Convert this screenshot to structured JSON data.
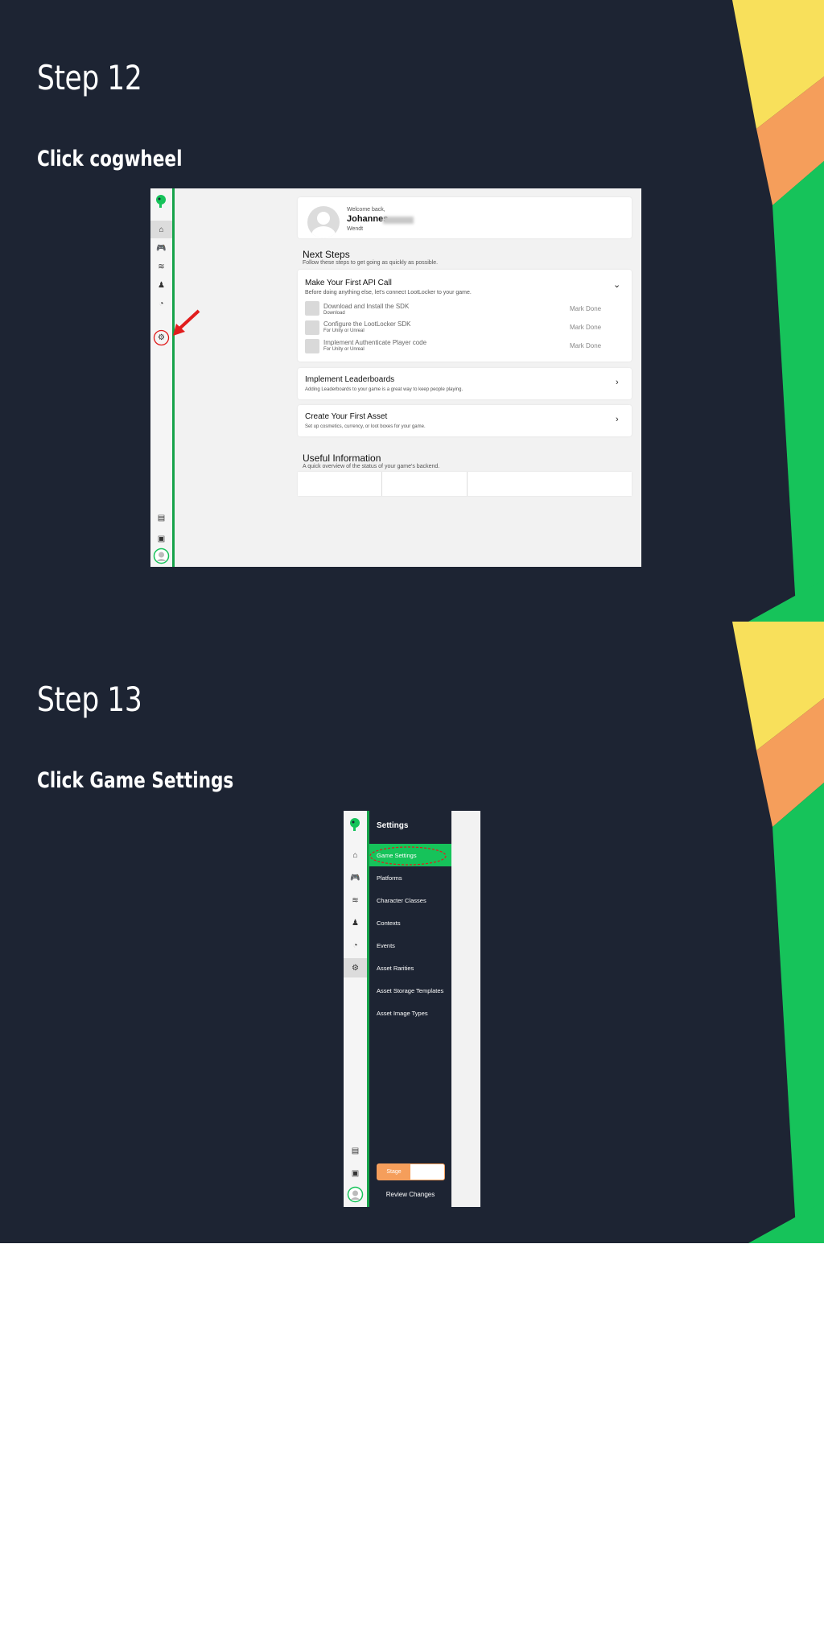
{
  "colors": {
    "slide_bg": "#1d2433",
    "accent_green": "#16c35a",
    "accent_orange": "#f59e5b",
    "accent_yellow": "#f8e05b",
    "highlight_red": "#e11d1d"
  },
  "step12": {
    "title": "Step 12",
    "instruction": "Click cogwheel",
    "screenshot": {
      "welcome": "Welcome back,",
      "user_name": "Johannes",
      "role": "Wendt",
      "next_steps_title": "Next Steps",
      "next_steps_sub": "Follow these steps to get going as quickly as possible.",
      "api_card": {
        "title": "Make Your First API Call",
        "sub": "Before doing anything else, let's connect LootLocker to your game.",
        "tasks": [
          {
            "label": "Download and Install the SDK",
            "sub": "Download",
            "action": "Mark Done"
          },
          {
            "label": "Configure the LootLocker SDK",
            "sub": "For Unity or Unreal",
            "action": "Mark Done"
          },
          {
            "label": "Implement Authenticate Player code",
            "sub": "For Unity or Unreal",
            "action": "Mark Done"
          }
        ]
      },
      "leaderboards_card": {
        "title": "Implement Leaderboards",
        "sub": "Adding Leaderboards to your game is a great way to keep people playing."
      },
      "asset_card": {
        "title": "Create Your First Asset",
        "sub": "Set up cosmetics, currency, or loot boxes for your game."
      },
      "useful_title": "Useful Information",
      "useful_sub": "A quick overview of the status of your game's backend."
    }
  },
  "step13": {
    "title": "Step 13",
    "instruction_prefix": "Click ",
    "instruction_bold": "Game Settings",
    "screenshot": {
      "menu_title": "Settings",
      "items": [
        "Game Settings",
        "Platforms",
        "Character Classes",
        "Contexts",
        "Events",
        "Asset Rarities",
        "Asset Storage Templates",
        "Asset Image Types"
      ],
      "stage_label": "Stage",
      "review_label": "Review Changes"
    }
  },
  "icons": [
    "home-icon",
    "gamepad-icon",
    "layers-icon",
    "player-icon",
    "gauge-icon",
    "gear-icon",
    "book-icon",
    "discord-icon",
    "user-avatar-icon",
    "red-arrow-icon"
  ]
}
